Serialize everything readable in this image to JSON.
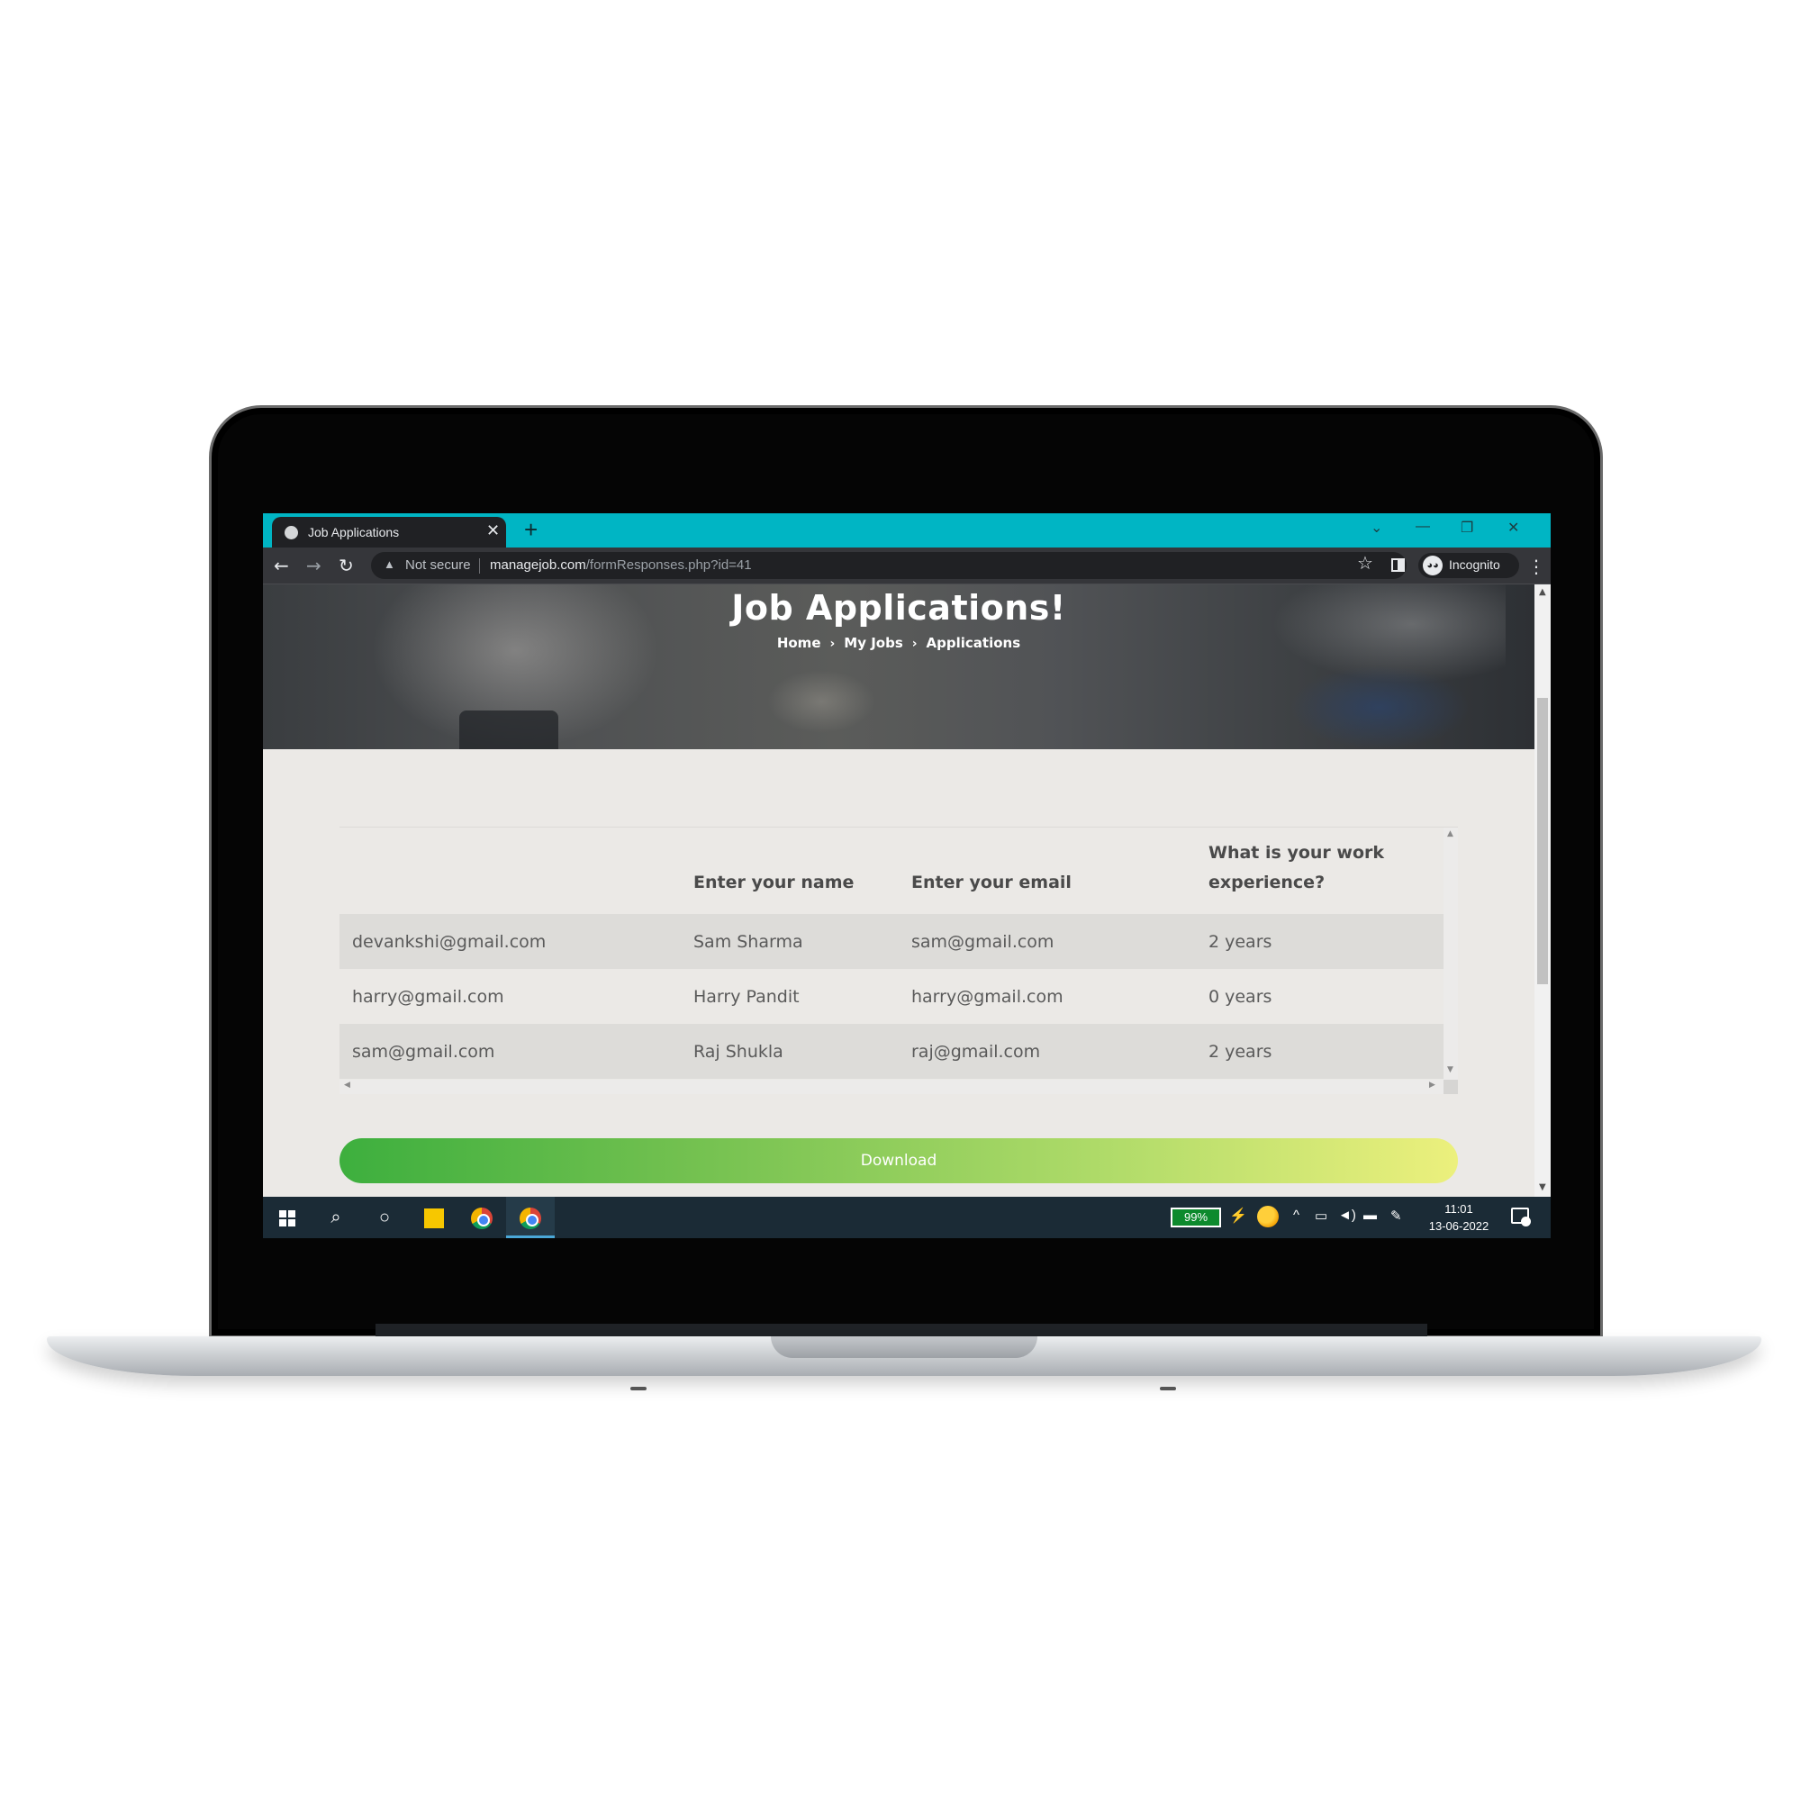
{
  "browser": {
    "tab_title": "Job Applications",
    "tab_close_glyph": "✕",
    "new_tab_glyph": "+",
    "security_label": "Not secure",
    "url_host": "managejob.com",
    "url_path": "/formResponses.php?id=41",
    "profile_label": "Incognito",
    "accent_color": "#00b5c4",
    "icons": [
      "globe-icon",
      "back-icon",
      "forward-icon",
      "reload-icon",
      "warning-icon",
      "star-icon",
      "side-panel-icon",
      "incognito-icon",
      "kebab-menu-icon",
      "minimize-icon",
      "restore-icon",
      "close-icon",
      "tab-search-icon"
    ]
  },
  "hero": {
    "title": "Job Applications!",
    "breadcrumbs": [
      "Home",
      "My Jobs",
      "Applications"
    ]
  },
  "table": {
    "headers": [
      "",
      "Enter your name",
      "Enter your email",
      "What is your work experience?"
    ],
    "rows": [
      [
        "devankshi@gmail.com",
        "Sam Sharma",
        "sam@gmail.com",
        "2 years"
      ],
      [
        "harry@gmail.com",
        "Harry Pandit",
        "harry@gmail.com",
        "0 years"
      ],
      [
        "sam@gmail.com",
        "Raj Shukla",
        "raj@gmail.com",
        "2 years"
      ]
    ]
  },
  "download_button": {
    "label": "Download",
    "gradient_start": "#3daf3e",
    "gradient_end": "#ecf07d"
  },
  "taskbar": {
    "battery_label": "99%",
    "time": "11:01",
    "date": "13-06-2022",
    "icons": [
      "windows-start-icon",
      "search-icon",
      "cortana-icon",
      "sticky-notes-icon",
      "chrome-icon",
      "chrome-incognito-icon",
      "plug-icon",
      "weather-icon",
      "chevron-up-icon",
      "network-icon",
      "volume-icon",
      "battery-tray-icon",
      "pen-icon",
      "notifications-icon"
    ]
  }
}
